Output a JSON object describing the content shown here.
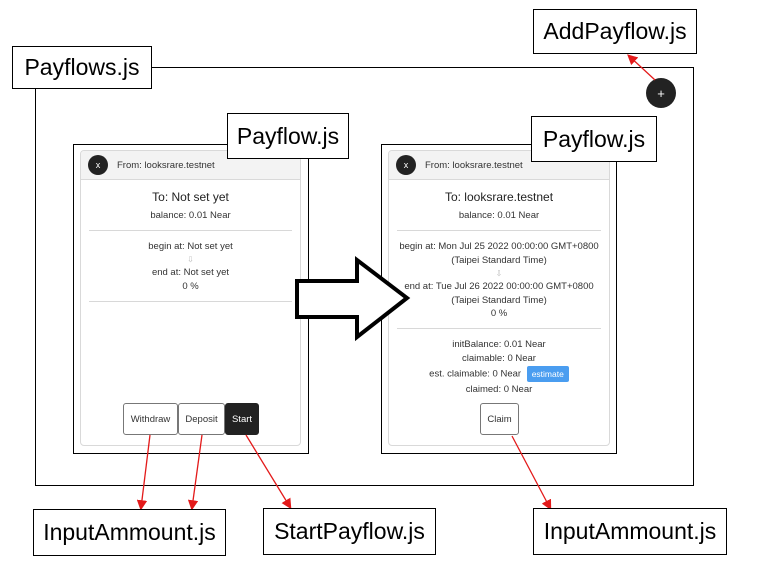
{
  "labels": {
    "add_payflow": "AddPayflow.js",
    "payflows": "Payflows.js",
    "payflow_left": "Payflow.js",
    "payflow_right": "Payflow.js",
    "input_amount_left": "InputAmmount.js",
    "start_payflow": "StartPayflow.js",
    "input_amount_right": "InputAmmount.js"
  },
  "add_button_label": "+",
  "left_card": {
    "close_label": "x",
    "from": "From: looksrare.testnet",
    "to": "To: Not set yet",
    "balance": "balance: 0.01 Near",
    "begin": "begin at: Not set yet",
    "arrow": "⇩",
    "end": "end at: Not set yet",
    "percent": "0 %",
    "withdraw_label": "Withdraw",
    "deposit_label": "Deposit",
    "start_label": "Start"
  },
  "right_card": {
    "close_label": "x",
    "from": "From: looksrare.testnet",
    "to": "To: looksrare.testnet",
    "balance": "balance: 0.01 Near",
    "begin_line1": "begin at: Mon Jul 25 2022 00:00:00 GMT+0800",
    "begin_line2": "(Taipei Standard Time)",
    "arrow": "⇩",
    "end_line1": "end at: Tue Jul 26 2022 00:00:00 GMT+0800",
    "end_line2": "(Taipei Standard Time)",
    "percent": "0 %",
    "init_balance": "initBalance: 0.01 Near",
    "claimable": "claimable: 0 Near",
    "est_claimable": "est. claimable: 0 Near",
    "estimate_label": "estimate",
    "claimed": "claimed: 0 Near",
    "claim_label": "Claim"
  },
  "colors": {
    "annotation_arrow": "#e31a1a",
    "estimate_button": "#4a9df0",
    "dark_button": "#222222"
  }
}
